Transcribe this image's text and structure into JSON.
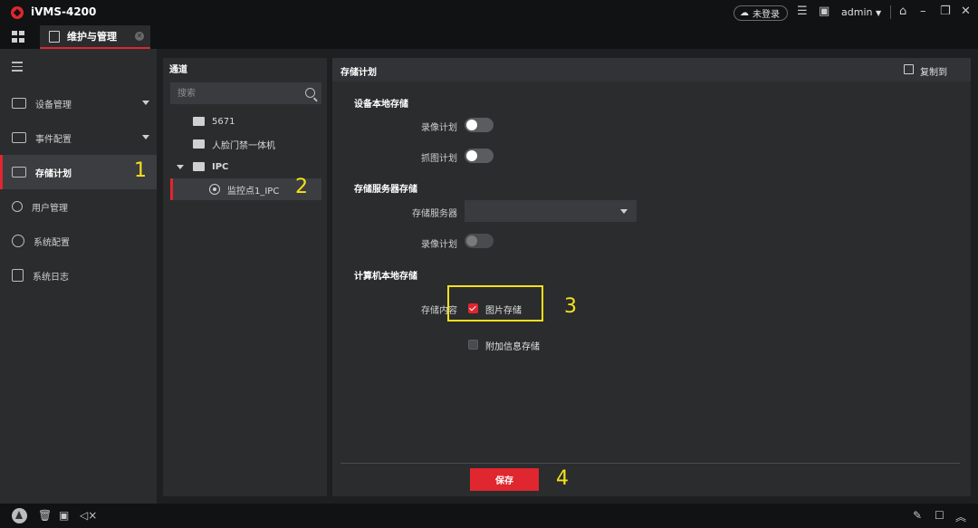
{
  "app": {
    "title": "iVMS-4200"
  },
  "titlebar": {
    "login_status": "未登录",
    "user": "admin"
  },
  "tabs": [
    {
      "label": "维护与管理"
    }
  ],
  "sidebar": {
    "items": [
      {
        "label": "设备管理",
        "expandable": true
      },
      {
        "label": "事件配置",
        "expandable": true
      },
      {
        "label": "存储计划",
        "active": true
      },
      {
        "label": "用户管理"
      },
      {
        "label": "系统配置"
      },
      {
        "label": "系统日志"
      }
    ]
  },
  "channel": {
    "title": "通道",
    "search_placeholder": "搜索",
    "tree": [
      {
        "label": "5671"
      },
      {
        "label": "人脸门禁一体机"
      },
      {
        "label": "IPC"
      },
      {
        "label": "监控点1_IPC"
      }
    ]
  },
  "main": {
    "title": "存储计划",
    "copy_label": "复制到",
    "local_storage": {
      "title": "设备本地存储",
      "record_label": "录像计划",
      "capture_label": "抓图计划"
    },
    "server_storage": {
      "title": "存储服务器存储",
      "server_label": "存储服务器",
      "server_value": "",
      "record_label": "录像计划"
    },
    "pc_storage": {
      "title": "计算机本地存储",
      "content_label": "存储内容",
      "picture_label": "图片存储",
      "picture_checked": true,
      "extra_label": "附加信息存储",
      "extra_checked": false
    },
    "save_label": "保存"
  },
  "annotations": {
    "m1": "1",
    "m2": "2",
    "m3": "3",
    "m4": "4"
  },
  "colors": {
    "accent": "#e0262e",
    "highlight": "#f5e11a"
  }
}
